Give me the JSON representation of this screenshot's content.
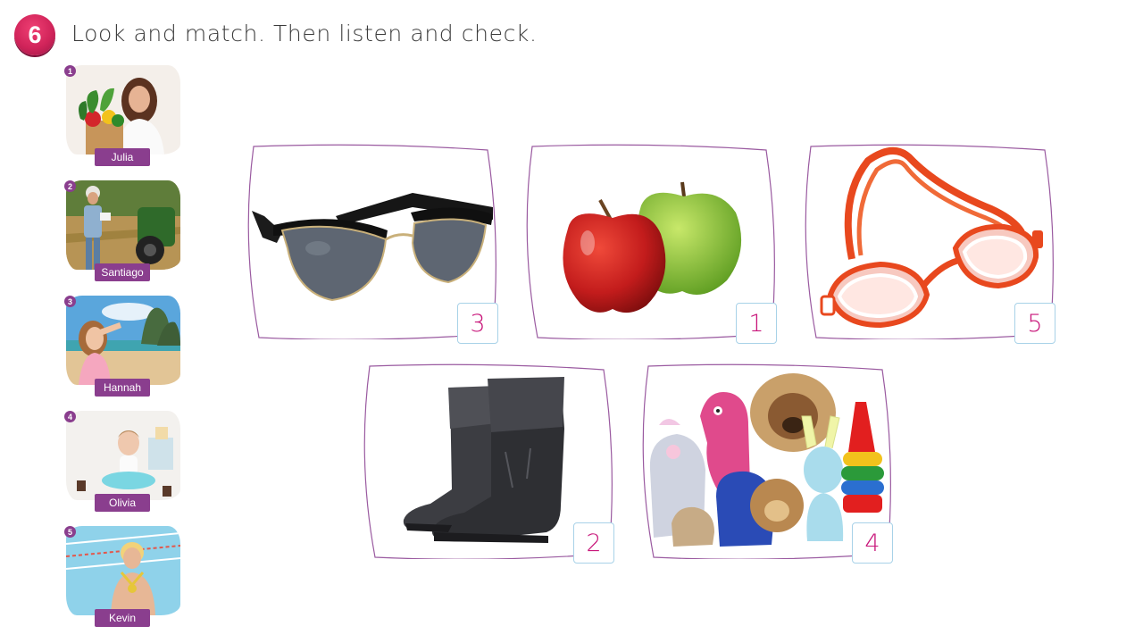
{
  "task": {
    "number": "6",
    "instruction": "Look and match. Then listen and check."
  },
  "people": [
    {
      "num": "1",
      "name": "Julia"
    },
    {
      "num": "2",
      "name": "Santiago"
    },
    {
      "num": "3",
      "name": "Hannah"
    },
    {
      "num": "4",
      "name": "Olivia"
    },
    {
      "num": "5",
      "name": "Kevin"
    }
  ],
  "items": [
    {
      "object": "sunglasses",
      "answer": "3"
    },
    {
      "object": "apples",
      "answer": "1"
    },
    {
      "object": "swimming goggles",
      "answer": "5"
    },
    {
      "object": "boots",
      "answer": "2"
    },
    {
      "object": "toys",
      "answer": "4"
    }
  ],
  "colors": {
    "accent": "#d1245a",
    "purple": "#8a3e8e",
    "answer_text": "#c8167a",
    "answer_border": "#a8d2e8"
  }
}
